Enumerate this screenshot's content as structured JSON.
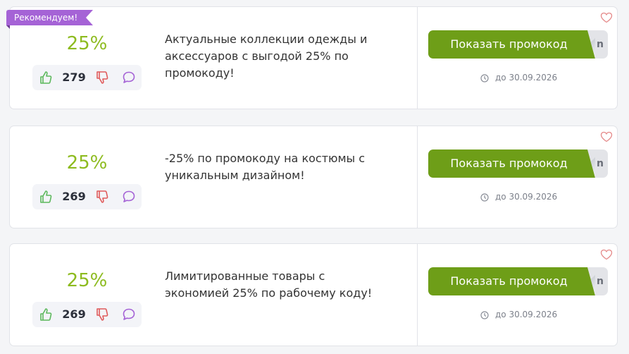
{
  "badge_label": "Рекомендуем!",
  "coupons": [
    {
      "discount": "25%",
      "likes": "279",
      "description": "Актуальные коллекции одежды и аксессуаров с выгодой 25% по промокоду!",
      "button_label": "Показать промокод",
      "code_hint": "n",
      "expiry": "до 30.09.2026"
    },
    {
      "discount": "25%",
      "likes": "269",
      "description": "-25% по промокоду на костюмы с уникальным дизайном!",
      "button_label": "Показать промокод",
      "code_hint": "n",
      "expiry": "до 30.09.2026"
    },
    {
      "discount": "25%",
      "likes": "269",
      "description": "Лимитированные товары с экономией 25% по рабочему коду!",
      "button_label": "Показать промокод",
      "code_hint": "n",
      "expiry": "до 30.09.2026"
    }
  ],
  "colors": {
    "discount": "#8dbb1f",
    "button": "#6e9e18",
    "badge": "#a563d6",
    "heart": "#e58a8a"
  },
  "icons": [
    "thumbs-up-icon",
    "thumbs-down-icon",
    "comment-icon",
    "clock-icon",
    "heart-icon"
  ]
}
